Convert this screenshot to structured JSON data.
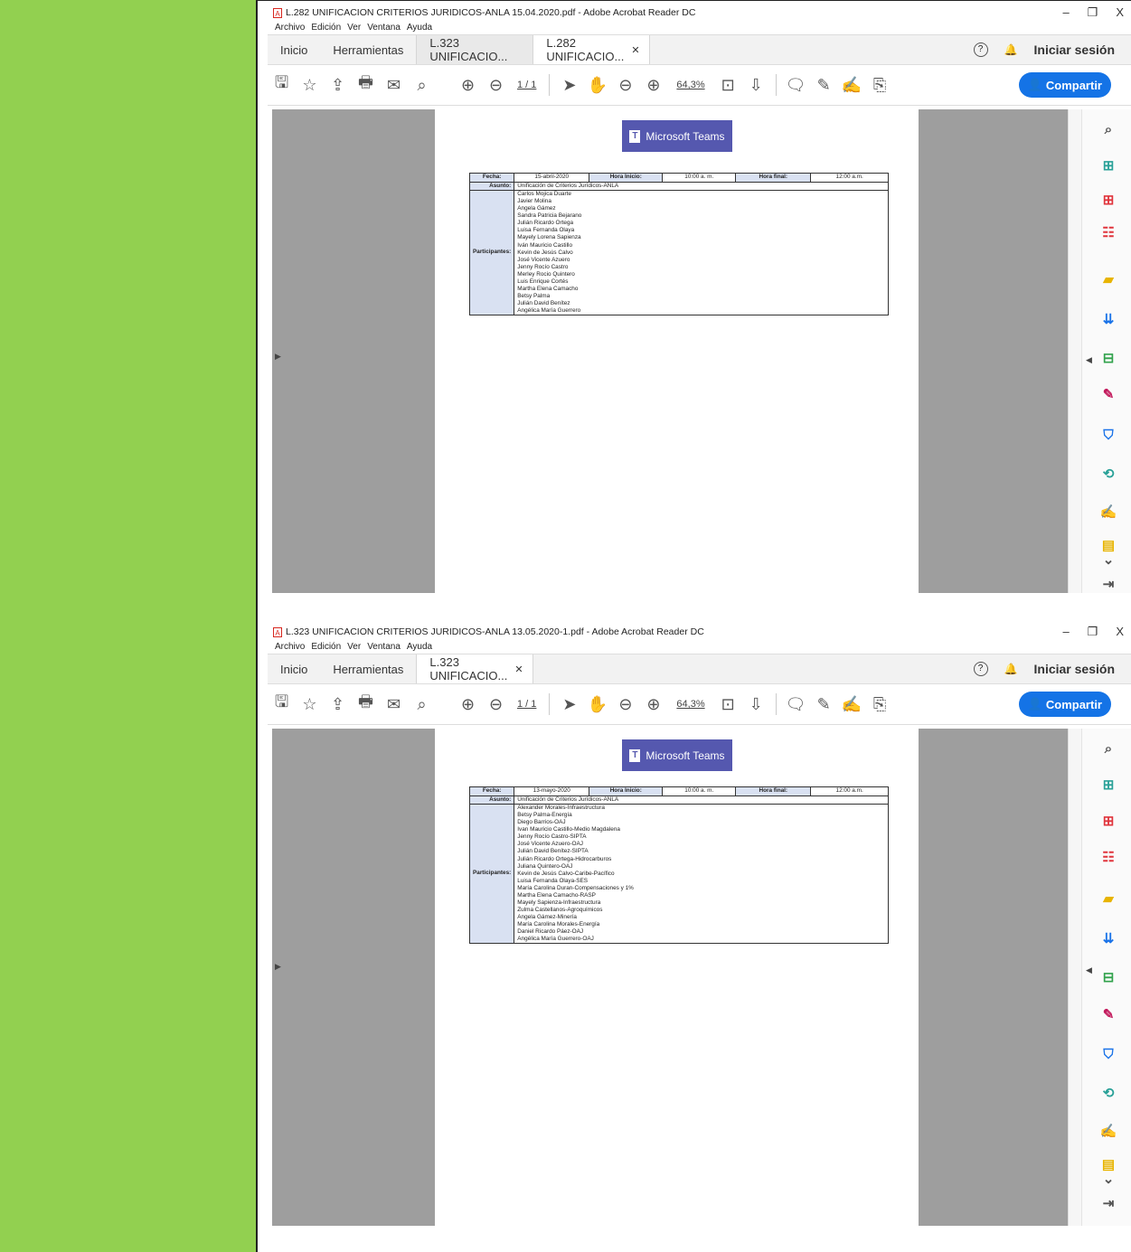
{
  "app_name": "Adobe Acrobat Reader DC",
  "menu": [
    "Archivo",
    "Edición",
    "Ver",
    "Ventana",
    "Ayuda"
  ],
  "tabs_common": {
    "home": "Inicio",
    "tools": "Herramientas"
  },
  "sign_in": "Iniciar sesión",
  "share": "Compartir",
  "page_indicator": "1 / 1",
  "zoom": "64,3%",
  "teams_banner": "Microsoft Teams",
  "labels": {
    "fecha": "Fecha:",
    "hora_inicio": "Hora Inicio:",
    "hora_final": "Hora final:",
    "asunto": "Asunto:",
    "participantes": "Participantes:"
  },
  "windows": [
    {
      "title": "L.282 UNIFICACION CRITERIOS JURIDICOS-ANLA 15.04.2020.pdf - Adobe Acrobat Reader DC",
      "doc_tabs": [
        "L.323 UNIFICACIO...",
        "L.282 UNIFICACIO..."
      ],
      "meeting": {
        "fecha": "15-abril-2020",
        "hora_inicio": "10:00 a. m.",
        "hora_final": "12:00 a.m.",
        "asunto": "Unificación de Criterios Jurídicos-ANLA",
        "participantes": [
          "Carlos Mojica Duarte",
          "Javier Molina",
          "Angela Gámez",
          "Sandra Patricia Bejarano",
          "Julián Ricardo Ortega",
          "Luisa Fernanda Olaya",
          "Mayely Lorena Sapienza",
          "Iván Mauricio Castillo",
          "Kevin de Jesús Calvo",
          "José Vicente Azuero",
          "Jenny Rocío Castro",
          "Merley Rocio Quintero",
          "Luis Enrique Cortés",
          "Martha Elena Camacho",
          "Betsy Palma",
          "Julián David Benítez",
          "Angélica María Guerrero"
        ]
      }
    },
    {
      "title": "L.323 UNIFICACION CRITERIOS JURIDICOS-ANLA 13.05.2020-1.pdf - Adobe Acrobat Reader DC",
      "doc_tabs": [
        "L.323 UNIFICACIO..."
      ],
      "meeting": {
        "fecha": "13-mayo-2020",
        "hora_inicio": "10:00 a. m.",
        "hora_final": "12:00 a.m.",
        "asunto": "Unificación de Criterios Jurídicos-ANLA",
        "participantes": [
          "Alexander Morales-Infraestructura",
          "Betsy Palma-Energía",
          "Diego Barrios-OAJ",
          "Ivan Mauricio Castillo-Medio Magdalena",
          "Jenny Rocío Castro-SIPTA",
          "José Vicente Azuero-OAJ",
          "Julián David Benítez-SIPTA",
          "Julián Ricardo Ortega-Hidrocarburos",
          "Juliana Quintero-OAJ",
          "Kevin de Jesús Calvo-Caribe-Pacífico",
          "Luisa Fernanda Olaya-SES",
          "María Carolina Duran-Compensaciones y 1%",
          "Martha Elena Camacho-RASP",
          "Mayely Sapienza-Infraestructura",
          "Zulma Castellanos-Agroquímicos",
          "Angela Gámez-Minería",
          "María Carolina Morales-Energía",
          "Daniel Ricardo Páez-OAJ",
          "Angélica María Guerrero-OAJ"
        ]
      }
    }
  ],
  "colors": {
    "green_panel": "#92d050",
    "share_blue": "#1473e6",
    "teams_purple": "#5558af",
    "label_bg": "#d9e1f2"
  }
}
